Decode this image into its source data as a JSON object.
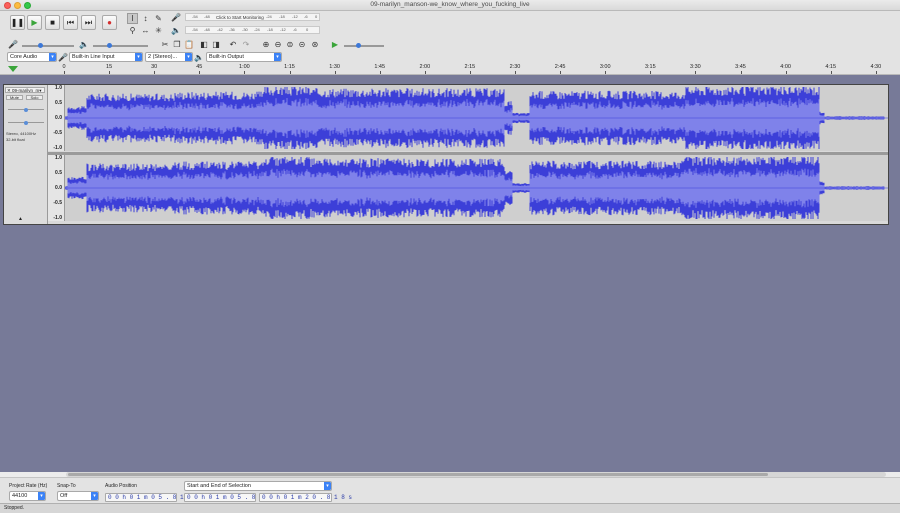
{
  "window": {
    "title": "09-marilyn_manson-we_know_where_you_fucking_live"
  },
  "transport": {
    "pause_icon": "pause-icon",
    "play_icon": "play-icon",
    "stop_icon": "stop-icon",
    "skip_start_icon": "skip-to-start-icon",
    "skip_end_icon": "skip-to-end-icon",
    "record_icon": "record-icon"
  },
  "meters": {
    "record_hint": "Click to Start Monitoring",
    "record_ticks": [
      "-54",
      "-48",
      "-42",
      "-36",
      "-30",
      "-24",
      "-18",
      "-12",
      "-6",
      "0"
    ],
    "play_ticks": [
      "-54",
      "-48",
      "-42",
      "-36",
      "-30",
      "-24",
      "-18",
      "-12",
      "-6",
      "0"
    ]
  },
  "devices": {
    "host": "Core Audio",
    "input": "Built-in Line Input",
    "channels": "2 (Stereo)...",
    "output": "Built-in Output"
  },
  "ruler": {
    "labels": [
      "0",
      "15",
      "30",
      "45",
      "1:00",
      "1:15",
      "1:30",
      "1:45",
      "2:00",
      "2:15",
      "2:30",
      "2:45",
      "3:00",
      "3:15",
      "3:30",
      "3:45",
      "4:00",
      "4:15",
      "4:30"
    ]
  },
  "track": {
    "name": "09-marilyn_m▾",
    "mute_label": "Mute",
    "solo_label": "Solo",
    "format_line1": "Stereo, 44100Hz",
    "format_line2": "32-bit float",
    "collapse_icon": "collapse-triangle-icon",
    "scale_labels": [
      "1.0",
      "0.5",
      "0.0",
      "-0.5",
      "-1.0"
    ]
  },
  "selection_toolbar": {
    "project_rate_label": "Project Rate (Hz)",
    "project_rate_value": "44100",
    "snap_to_label": "Snap-To",
    "snap_to_value": "Off",
    "audio_position_label": "Audio Position",
    "audio_position_value": "0 0 h 0 1 m 0 5 . 8 1 8 s",
    "selection_mode": "Start and End of Selection",
    "selection_start": "0 0 h 0 1 m 0 5 . 8 1 8 s",
    "selection_end": "0 0 h 0 1 m 2 0 . 8 1 8 s"
  },
  "status": {
    "text": "Stopped."
  },
  "colors": {
    "wave_peak": "#3c3fd8",
    "wave_rms": "#7f82ea",
    "wave_bg": "#cfcfcf",
    "empty_area": "#777a98"
  }
}
